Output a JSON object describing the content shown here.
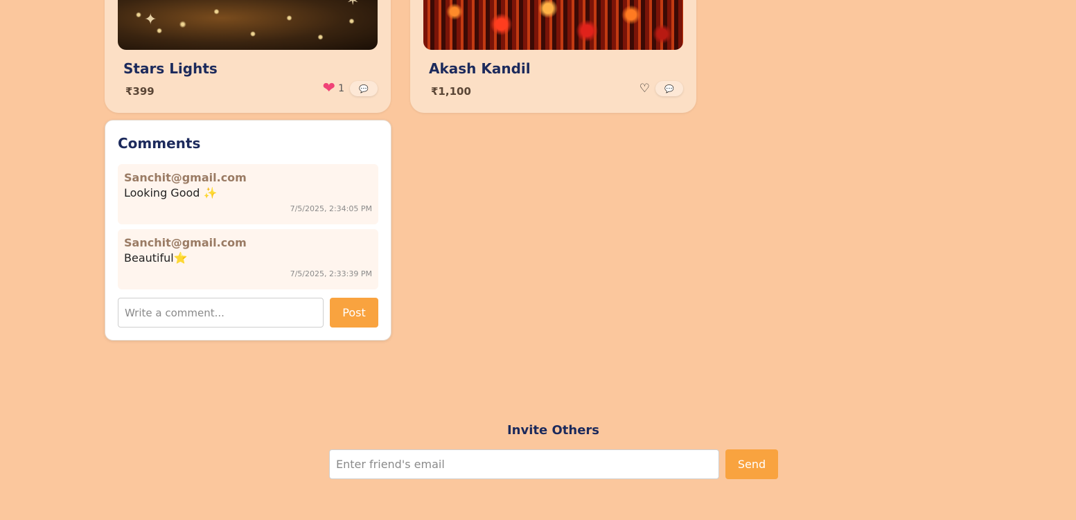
{
  "products": [
    {
      "title": "Stars Lights",
      "price": "₹399",
      "liked": true,
      "like_count": "1",
      "image_icon": "stars-lights-photo"
    },
    {
      "title": "Akash Kandil",
      "price": "₹1,100",
      "liked": false,
      "like_count": "",
      "image_icon": "akash-kandil-photo"
    }
  ],
  "icons": {
    "heart_filled": "❤",
    "heart_outline": "♡",
    "comment_bubble": "💬"
  },
  "comments": {
    "title": "Comments",
    "items": [
      {
        "author": "Sanchit@gmail.com",
        "text": "Looking Good ✨",
        "time": "7/5/2025, 2:34:05 PM"
      },
      {
        "author": "Sanchit@gmail.com",
        "text": "Beautiful⭐",
        "time": "7/5/2025, 2:33:39 PM"
      }
    ],
    "input_placeholder": "Write a comment...",
    "post_label": "Post"
  },
  "invite": {
    "title": "Invite Others",
    "input_placeholder": "Enter friend's email",
    "send_label": "Send"
  },
  "colors": {
    "background": "#fbc79d",
    "card": "#fcdfc5",
    "accent": "#f9a33f",
    "heading": "#1c2a5c",
    "heart": "#f04377"
  }
}
